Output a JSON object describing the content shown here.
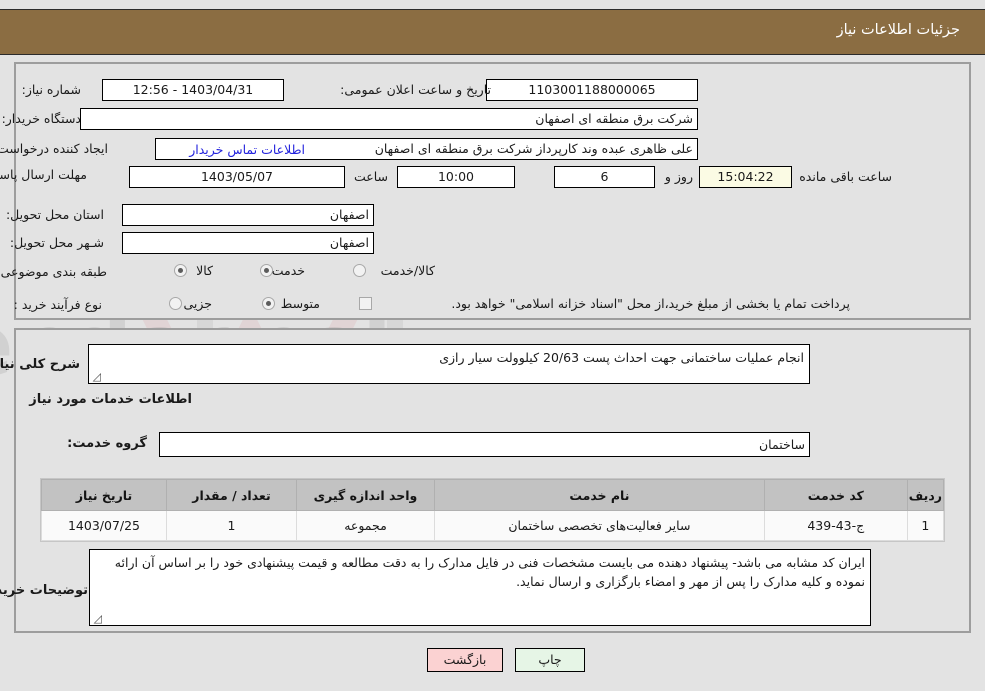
{
  "header": {
    "title": "جزئیات اطلاعات نیاز"
  },
  "summary": {
    "need_number_label": "شماره نیاز:",
    "need_number_value": "1103001188000065",
    "announce_datetime_label": "تاریخ و ساعت اعلان عمومی:",
    "announce_datetime_value": "1403/04/31 - 12:56",
    "buyer_org_label": "نام دستگاه خریدار:",
    "buyer_org_value": "شرکت برق منطقه ای اصفهان",
    "requester_label": "ایجاد کننده درخواست:",
    "requester_value": "علی ظاهری عبده وند کارپرداز شرکت برق منطقه ای اصفهان",
    "requester_secondary_value": "شرکت برق منطقه ای اصفهان",
    "buyer_contact_link": "اطلاعات تماس خریدار",
    "deadline_label": "مهلت ارسال پاسخ: تا تاریخ:",
    "deadline_date_value": "1403/05/07",
    "deadline_time_label": "ساعت",
    "deadline_time_value": "10:00",
    "remaining_days_value": "6",
    "remaining_days_label": "روز و",
    "remaining_clock_value": "15:04:22",
    "remaining_suffix_label": "ساعت باقی مانده",
    "province_label": "استان محل تحویل:",
    "province_value": "اصفهان",
    "city_label": "شـهر محل تحویل:",
    "city_value": "اصفهان",
    "category_label": "طبقه بندی موضوعی:",
    "category_options": [
      {
        "label": "کالا",
        "checked": false
      },
      {
        "label": "خدمت",
        "checked": true
      },
      {
        "label": "کالا/خدمت",
        "checked": false
      }
    ],
    "process_label": "نوع فرآیند خرید :",
    "process_options": [
      {
        "label": "جزیی",
        "checked": false
      },
      {
        "label": "متوسط",
        "checked": true
      }
    ],
    "process_checkbox_label": "پرداخت تمام یا بخشی از مبلغ خرید،از محل \"اسناد خزانه اسلامی\" خواهد بود.",
    "process_checkbox_checked": false
  },
  "details": {
    "need_desc_label": "شرح کلی نیاز:",
    "need_desc_value": "انجام عملیات ساختمانی جهت احداث پست 20/63 کیلوولت سیار رازی",
    "services_section_title": "اطلاعات خدمات مورد نیاز",
    "service_group_label": "گروه خدمت:",
    "service_group_value": "ساختمان",
    "buyer_notes_label": "توضیحات خریدار:",
    "buyer_notes_value": "ایران کد مشابه می باشد- پیشنهاد دهنده می بایست مشخصات فنی در فایل مدارک  را به دقت مطالعه و قیمت پیشنهادی خود را بر اساس آن ارائه نموده و کلیه مدارک را پس از مهر و امضاء بارگزاری و ارسال نماید."
  },
  "table": {
    "columns": [
      "ردیف",
      "کد خدمت",
      "نام خدمت",
      "واحد اندازه گیری",
      "تعداد / مقدار",
      "تاریخ نیاز"
    ],
    "rows": [
      {
        "row_no": "1",
        "service_code": "ج-43-439",
        "service_name": "سایر فعالیت‌های تخصصی ساختمان",
        "unit": "مجموعه",
        "quantity": "1",
        "need_date": "1403/07/25"
      }
    ]
  },
  "footer": {
    "print_label": "چاپ",
    "back_label": "بازگشت"
  },
  "watermark": {
    "text": "AriaTender.net"
  },
  "colors": {
    "header_bg": "#8b6d42",
    "page_bg": "#e3e3e3",
    "link": "#2222dd",
    "table_header_bg": "#c2c2c2",
    "print_btn_bg": "#e6f5e6",
    "back_btn_bg": "#fbd2d2",
    "highlight_field_bg": "#fbfbe4"
  }
}
